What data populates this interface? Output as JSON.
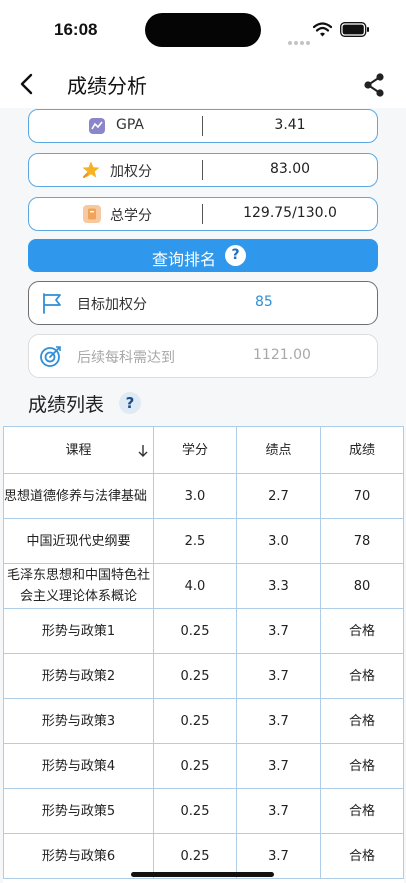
{
  "status_bar": {
    "time": "16:08"
  },
  "nav": {
    "title": "成绩分析"
  },
  "stats": [
    {
      "label": "GPA",
      "value": "3.41",
      "icon": "gpa-icon",
      "icon_color": "#8b85c9"
    },
    {
      "label": "加权分",
      "value": "83.00",
      "icon": "star-icon",
      "icon_color": "#f5b223"
    },
    {
      "label": "总学分",
      "value": "129.75/130.0",
      "icon": "credit-book-icon",
      "icon_color": "#f0a45a"
    }
  ],
  "query_button": {
    "label": "查询排名",
    "help": "?"
  },
  "target": {
    "label": "目标加权分",
    "value": "85"
  },
  "need": {
    "label": "后续每科需达到",
    "value": "1121.00"
  },
  "grades_section": {
    "title": "成绩列表",
    "help": "?"
  },
  "grades_table": {
    "headers": [
      "课程",
      "学分",
      "绩点",
      "成绩"
    ],
    "rows": [
      [
        "思想道德修养与法律基础",
        "3.0",
        "2.7",
        "70"
      ],
      [
        "中国近现代史纲要",
        "2.5",
        "3.0",
        "78"
      ],
      [
        "毛泽东思想和中国特色社会主义理论体系概论",
        "4.0",
        "3.3",
        "80"
      ],
      [
        "形势与政策1",
        "0.25",
        "3.7",
        "合格"
      ],
      [
        "形势与政策2",
        "0.25",
        "3.7",
        "合格"
      ],
      [
        "形势与政策3",
        "0.25",
        "3.7",
        "合格"
      ],
      [
        "形势与政策4",
        "0.25",
        "3.7",
        "合格"
      ],
      [
        "形势与政策5",
        "0.25",
        "3.7",
        "合格"
      ],
      [
        "形势与政策6",
        "0.25",
        "3.7",
        "合格"
      ]
    ]
  },
  "colors": {
    "accent": "#2f98ec",
    "pill_border": "#5ba8e2",
    "table_border": "#aecde9",
    "target_value": "#2f8fd8",
    "muted": "#a8a8a8"
  }
}
